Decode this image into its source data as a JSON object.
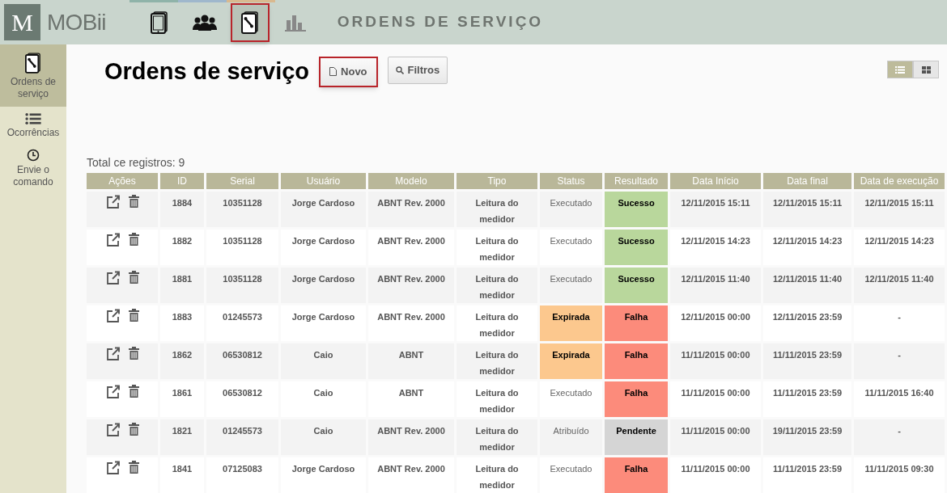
{
  "brand": {
    "logo_letter": "M",
    "name": "MOBii"
  },
  "top_nav": [
    {
      "kind": "tablet",
      "selected": false
    },
    {
      "kind": "users",
      "selected": false
    },
    {
      "kind": "tablet-wrench",
      "selected": true
    },
    {
      "kind": "chart",
      "selected": false
    }
  ],
  "section_title": "ORDENS DE SERVIÇO",
  "sidebar": [
    {
      "kind": "tablet-wrench",
      "label": "Ordens de serviço",
      "selected": true
    },
    {
      "kind": "list",
      "label": "Ocorrências",
      "selected": false
    },
    {
      "kind": "clock",
      "label": "Envie o comando",
      "selected": false
    }
  ],
  "page_title": "Ordens de serviço",
  "buttons": [
    {
      "kind": "new",
      "label": "Novo",
      "highlighted": true
    },
    {
      "kind": "search",
      "label": "Filtros",
      "highlighted": false
    }
  ],
  "view_toggle": [
    {
      "kind": "list",
      "selected": true
    },
    {
      "kind": "grid",
      "selected": false
    }
  ],
  "total": "Total ce registros: 9",
  "table": {
    "columns": [
      "Ações",
      "ID",
      "Serial",
      "Usuário",
      "Modelo",
      "Tipo",
      "Status",
      "Resultado",
      "Data Início",
      "Data final",
      "Data de execução"
    ],
    "rows": [
      {
        "id": "1884",
        "serial": "10351128",
        "user": "Jorge Cardoso",
        "model": "ABNT Rev. 2000",
        "type": "Leitura do medidor",
        "status": {
          "text": "Executado",
          "highlighted": false
        },
        "result": {
          "text": "Sucesso",
          "color": "#b9d79c"
        },
        "start": "12/11/2015 15:11",
        "end": "12/11/2015 15:11",
        "executed": "12/11/2015 15:11"
      },
      {
        "id": "1882",
        "serial": "10351128",
        "user": "Jorge Cardoso",
        "model": "ABNT Rev. 2000",
        "type": "Leitura do medidor",
        "status": {
          "text": "Executado",
          "highlighted": false
        },
        "result": {
          "text": "Sucesso",
          "color": "#b9d79c"
        },
        "start": "12/11/2015 14:23",
        "end": "12/11/2015 14:23",
        "executed": "12/11/2015 14:23"
      },
      {
        "id": "1881",
        "serial": "10351128",
        "user": "Jorge Cardoso",
        "model": "ABNT Rev. 2000",
        "type": "Leitura do medidor",
        "status": {
          "text": "Executado",
          "highlighted": false
        },
        "result": {
          "text": "Sucesso",
          "color": "#b9d79c"
        },
        "start": "12/11/2015 11:40",
        "end": "12/11/2015 11:40",
        "executed": "12/11/2015 11:40"
      },
      {
        "id": "1883",
        "serial": "01245573",
        "user": "Jorge Cardoso",
        "model": "ABNT Rev. 2000",
        "type": "Leitura do medidor",
        "status": {
          "text": "Expirada",
          "highlighted": true
        },
        "result": {
          "text": "Falha",
          "color": "#fc8b7b"
        },
        "start": "12/11/2015 00:00",
        "end": "12/11/2015 23:59",
        "executed": "-"
      },
      {
        "id": "1862",
        "serial": "06530812",
        "user": "Caio",
        "model": "ABNT",
        "type": "Leitura do medidor",
        "status": {
          "text": "Expirada",
          "highlighted": true
        },
        "result": {
          "text": "Falha",
          "color": "#fc8b7b"
        },
        "start": "11/11/2015 00:00",
        "end": "11/11/2015 23:59",
        "executed": "-"
      },
      {
        "id": "1861",
        "serial": "06530812",
        "user": "Caio",
        "model": "ABNT",
        "type": "Leitura do medidor",
        "status": {
          "text": "Executado",
          "highlighted": false
        },
        "result": {
          "text": "Falha",
          "color": "#fc8b7b"
        },
        "start": "11/11/2015 00:00",
        "end": "11/11/2015 23:59",
        "executed": "11/11/2015 16:40"
      },
      {
        "id": "1821",
        "serial": "01245573",
        "user": "Caio",
        "model": "ABNT Rev. 2000",
        "type": "Leitura do medidor",
        "status": {
          "text": "Atribuído",
          "highlighted": false
        },
        "result": {
          "text": "Pendente",
          "color": "#d5d5d5"
        },
        "start": "11/11/2015 00:00",
        "end": "19/11/2015 23:59",
        "executed": "-"
      },
      {
        "id": "1841",
        "serial": "07125083",
        "user": "Jorge Cardoso",
        "model": "ABNT Rev. 2000",
        "type": "Leitura do medidor",
        "status": {
          "text": "Executado",
          "highlighted": false
        },
        "result": {
          "text": "Falha",
          "color": "#fc8b7b"
        },
        "start": "11/11/2015 00:00",
        "end": "11/11/2015 23:59",
        "executed": "11/11/2015 09:30"
      }
    ]
  }
}
